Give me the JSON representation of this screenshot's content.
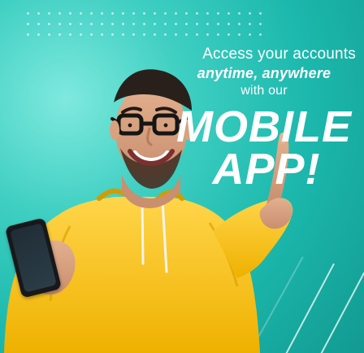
{
  "banner": {
    "line1": "Access your accounts",
    "line2": "anytime, anywhere",
    "line3": "with our",
    "line4": "MOBILE",
    "line5": "APP!"
  },
  "icons": {
    "phone": "mobile-phone-icon"
  },
  "colors": {
    "background_start": "#7fe9de",
    "background_end": "#129a91",
    "hoodie": "#f0b800",
    "text": "#ffffff"
  }
}
